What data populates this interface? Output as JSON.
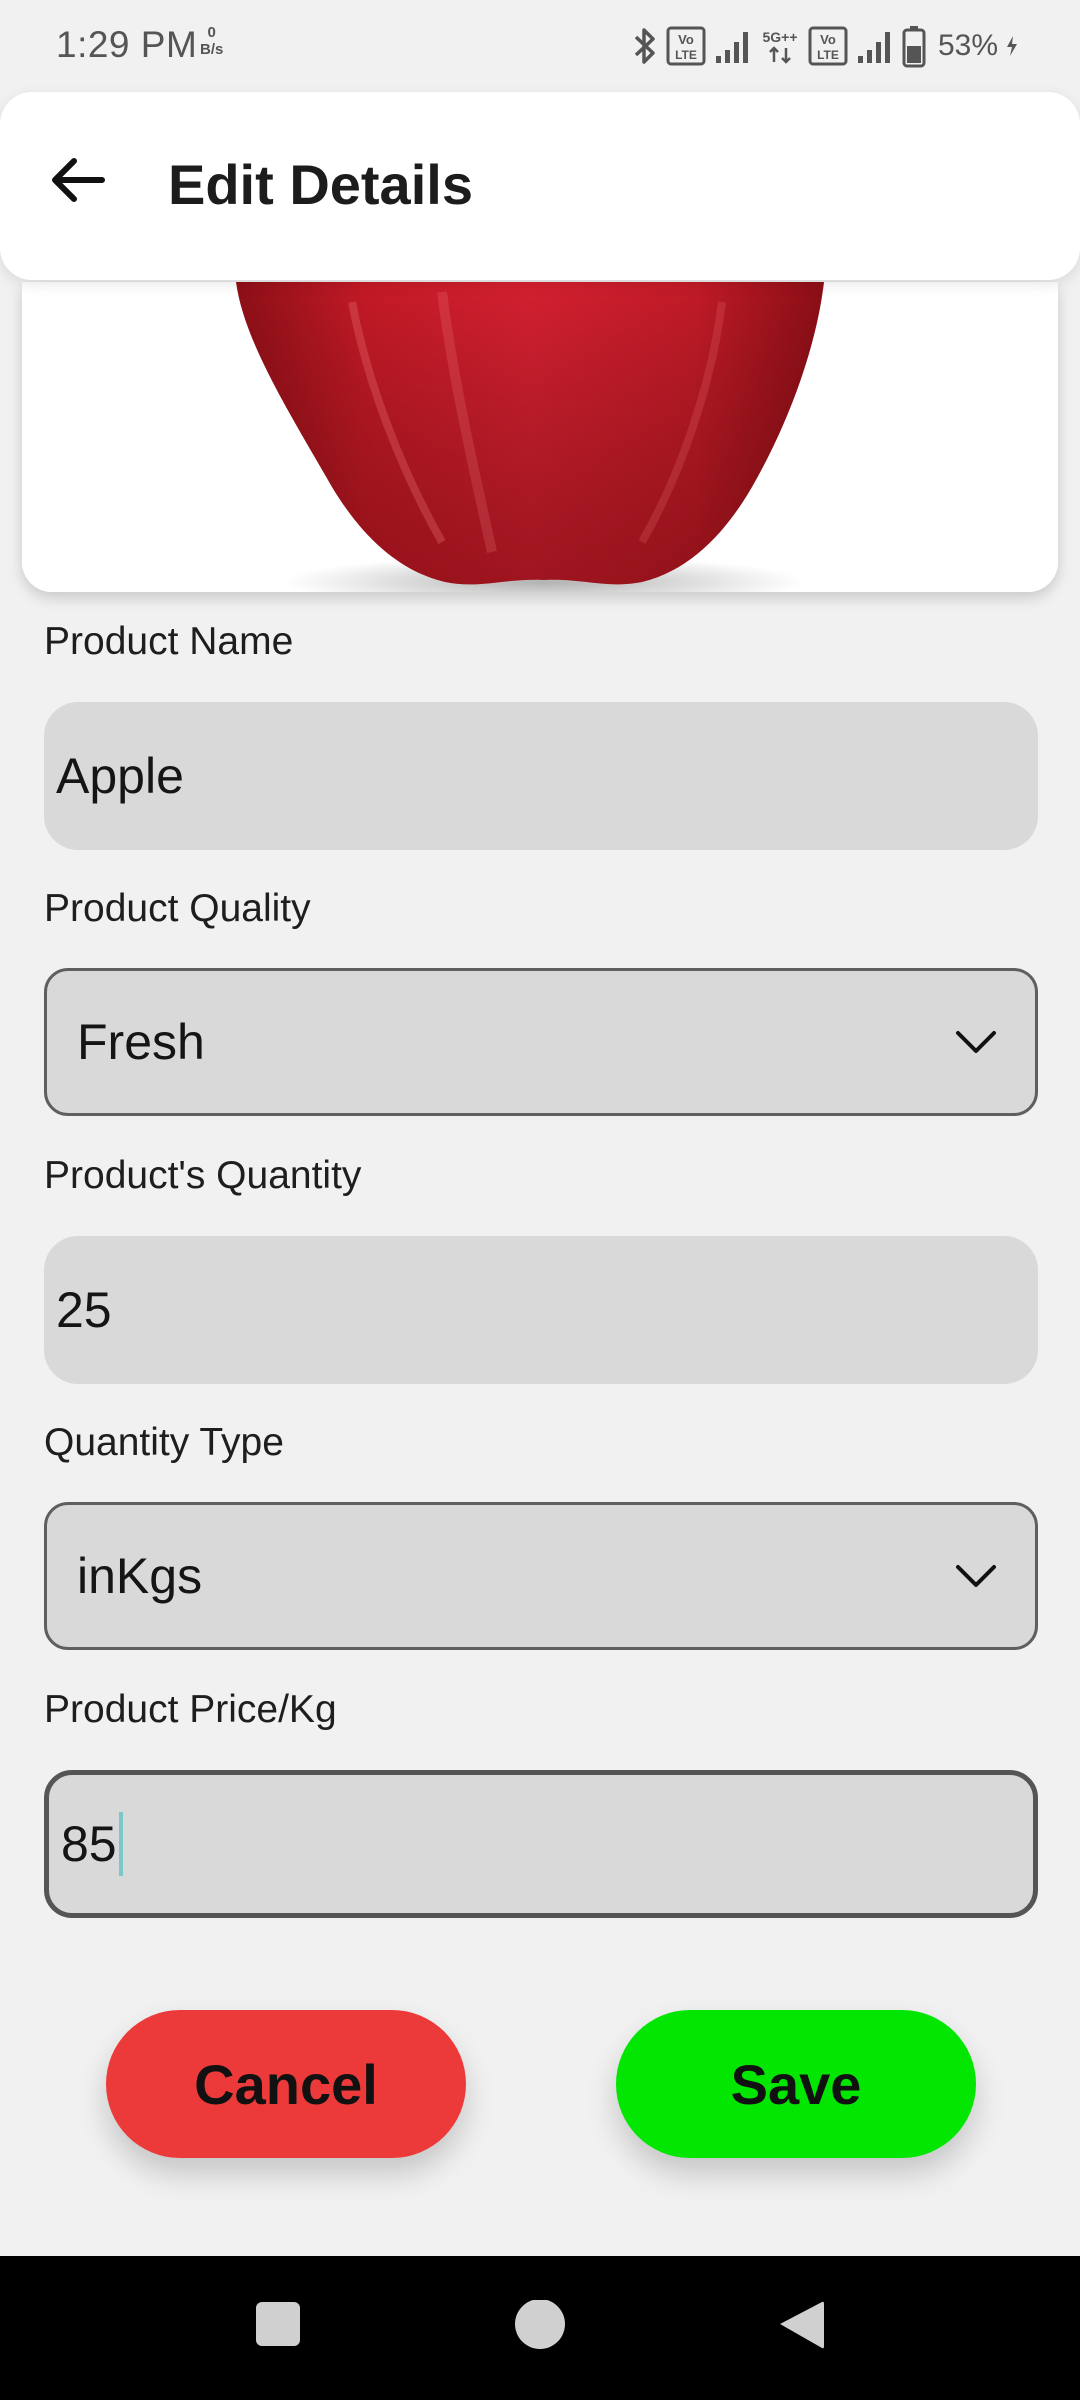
{
  "status_bar": {
    "time": "1:29 PM",
    "net_speed_value": "0",
    "net_speed_unit": "B/s",
    "volte_label": "Vo LTE",
    "network_type": "5G++",
    "battery_percent": "53%",
    "icons": [
      "bluetooth-icon",
      "volte-icon",
      "signal-icon",
      "5g-icon",
      "volte-icon",
      "signal-icon",
      "battery-icon",
      "charging-icon"
    ]
  },
  "app_bar": {
    "title": "Edit Details",
    "back_icon": "arrow-left-icon"
  },
  "product_image": {
    "subject": "red apple"
  },
  "form": {
    "product_name": {
      "label": "Product Name",
      "value": "Apple"
    },
    "product_quality": {
      "label": "Product Quality",
      "value": "Fresh"
    },
    "product_quantity": {
      "label": "Product's Quantity",
      "value": "25"
    },
    "quantity_type": {
      "label": "Quantity Type",
      "value": "inKgs"
    },
    "product_price": {
      "label": "Product Price/Kg",
      "value": "85"
    }
  },
  "actions": {
    "cancel_label": "Cancel",
    "save_label": "Save",
    "cancel_color": "#ec3a3a",
    "save_color": "#02e602"
  },
  "nav_bar": {
    "icons": [
      "recents-square-icon",
      "home-circle-icon",
      "back-triangle-icon"
    ]
  }
}
